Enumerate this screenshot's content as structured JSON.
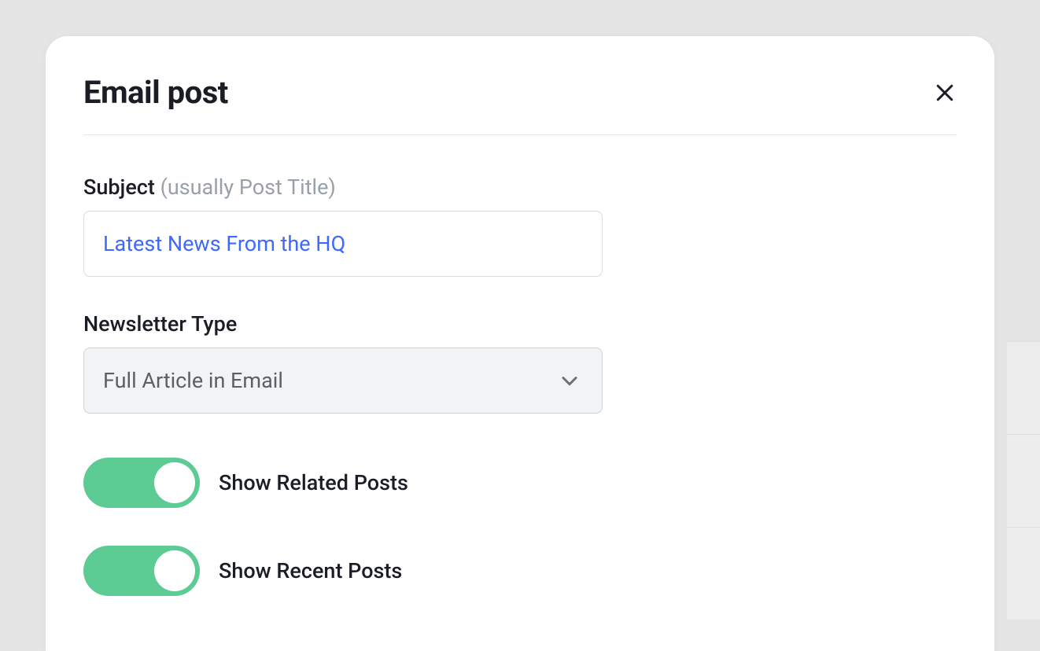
{
  "modal": {
    "title": "Email post",
    "subject": {
      "label": "Subject",
      "hint": "(usually Post Title)",
      "value": "Latest News From the HQ"
    },
    "newsletter_type": {
      "label": "Newsletter Type",
      "selected": "Full Article in Email"
    },
    "toggles": {
      "related": {
        "label": "Show Related Posts",
        "on": true
      },
      "recent": {
        "label": "Show Recent Posts",
        "on": true
      }
    }
  }
}
